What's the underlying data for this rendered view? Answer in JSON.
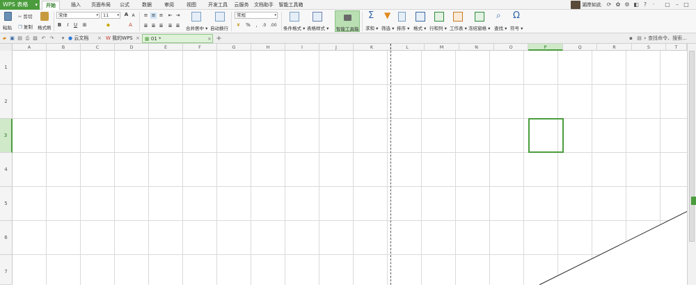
{
  "app": {
    "name": "WPS 表格",
    "dropdown": "▾"
  },
  "menu_tabs": [
    "开始",
    "插入",
    "页面布局",
    "公式",
    "数据",
    "审阅",
    "视图",
    "开发工具",
    "云服务",
    "文档助手",
    "智能工具箱"
  ],
  "user": {
    "name": "湖岸如此"
  },
  "ribbon": {
    "paste": "粘贴",
    "cut": "剪切",
    "copy": "复制",
    "format_painter": "格式刷",
    "font_name": "宋体",
    "font_size": "11",
    "merge_center": "合并居中",
    "wrap_text": "自动换行",
    "number_format": "常规",
    "conditional_format": "条件格式",
    "table_style": "表格样式",
    "smart_toolbox": "智能工具箱",
    "sum": "求和",
    "filter": "筛选",
    "sort": "排序",
    "format": "格式",
    "row_col": "行和列",
    "worksheet": "工作表",
    "freeze": "冻结窗格",
    "find": "查找",
    "symbol": "符号",
    "bold": "B",
    "italic": "I",
    "underline": "U",
    "percent": "%"
  },
  "doc_tabs": [
    {
      "label": "云文档",
      "active": false
    },
    {
      "label": "我的WPS",
      "active": false
    },
    {
      "label": "01 *",
      "active": true
    }
  ],
  "search_command": "查找命令、搜索...",
  "columns": [
    "A",
    "B",
    "C",
    "D",
    "E",
    "F",
    "G",
    "H",
    "I",
    "J",
    "K",
    "L",
    "M",
    "N",
    "O",
    "P",
    "Q",
    "R",
    "S",
    "T"
  ],
  "rows": [
    "1",
    "2",
    "3",
    "4",
    "5",
    "6",
    "7"
  ],
  "selected": {
    "column": "P",
    "row": "3"
  },
  "colors": {
    "accent": "#4a9c3c",
    "selection": "#4a9c3c"
  }
}
